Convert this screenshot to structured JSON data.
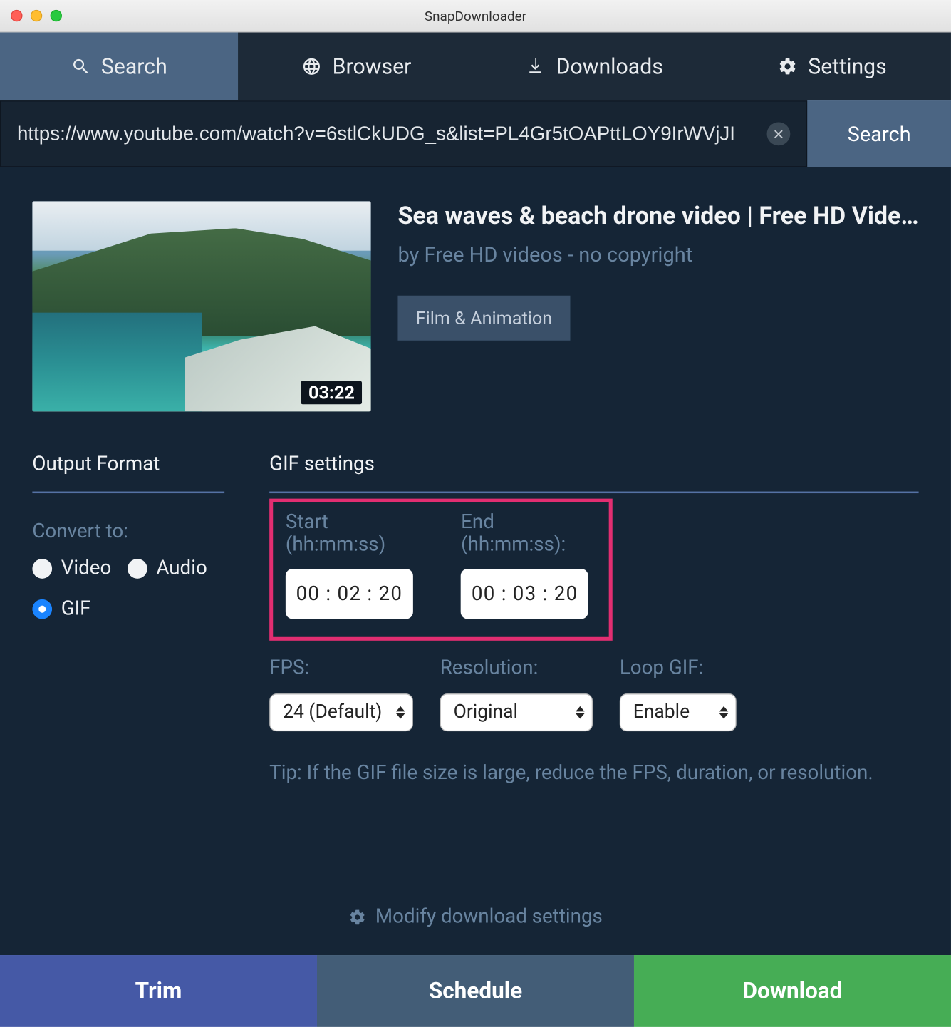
{
  "window": {
    "title": "SnapDownloader"
  },
  "tabs": {
    "search": "Search",
    "browser": "Browser",
    "downloads": "Downloads",
    "settings": "Settings"
  },
  "urlbar": {
    "value": "https://www.youtube.com/watch?v=6stlCkUDG_s&list=PL4Gr5tOAPttLOY9IrWVjJI",
    "search_btn": "Search"
  },
  "video": {
    "title": "Sea waves & beach drone video | Free HD Vide…",
    "author": "by Free HD videos - no copyright",
    "category": "Film & Animation",
    "duration": "03:22"
  },
  "output_format": {
    "header": "Output Format",
    "convert_to": "Convert to:",
    "options": {
      "video": "Video",
      "audio": "Audio",
      "gif": "GIF"
    },
    "selected": "GIF"
  },
  "gif_settings": {
    "header": "GIF settings",
    "start_label": "Start (hh:mm:ss)",
    "end_label": "End (hh:mm:ss):",
    "start_value": "00 : 02 : 20",
    "end_value": "00 : 03 : 20",
    "fps_label": "FPS:",
    "fps_value": "24 (Default)",
    "resolution_label": "Resolution:",
    "resolution_value": "Original",
    "loop_label": "Loop GIF:",
    "loop_value": "Enable",
    "tip": "Tip: If the GIF file size is large, reduce the FPS, duration, or resolution."
  },
  "footer": {
    "modify": "Modify download settings"
  },
  "actions": {
    "trim": "Trim",
    "schedule": "Schedule",
    "download": "Download"
  }
}
